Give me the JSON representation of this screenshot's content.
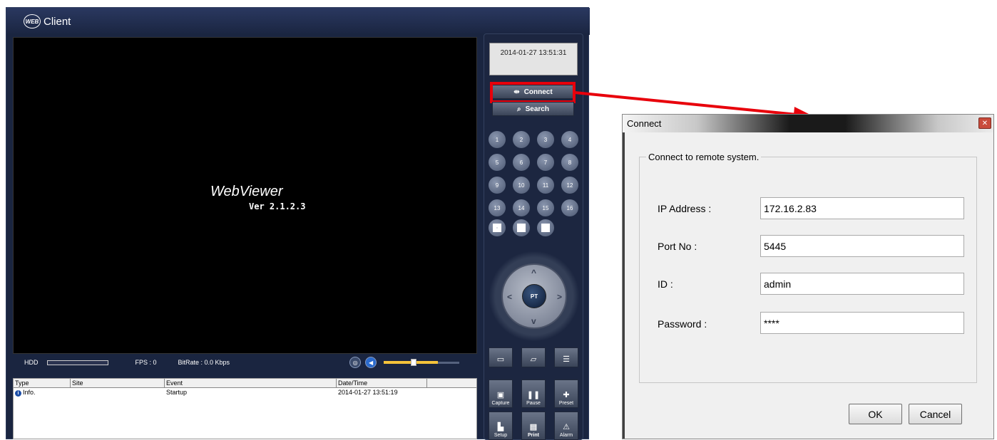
{
  "app": {
    "logo_text": "WEB",
    "title": "Client"
  },
  "viewer": {
    "name": "WebViewer",
    "version": "Ver 2.1.2.3"
  },
  "status": {
    "hdd_label": "HDD",
    "fps": "FPS :  0",
    "bitrate": "BitRate : 0.0 Kbps",
    "volume_level": 0.5
  },
  "log": {
    "columns": [
      "Type",
      "Site",
      "Event",
      "Date/Time"
    ],
    "rows": [
      {
        "type": "Info.",
        "site": "",
        "event": "Startup",
        "datetime": "2014-01-27 13:51:19"
      }
    ]
  },
  "panel": {
    "clock": "2014-01-27 13:51:31",
    "connect_label": "Connect",
    "search_label": "Search",
    "channels": [
      "1",
      "2",
      "3",
      "4",
      "5",
      "6",
      "7",
      "8",
      "9",
      "10",
      "11",
      "12",
      "13",
      "14",
      "15",
      "16"
    ],
    "ptz_label": "PT",
    "tools": [
      {
        "label": "",
        "icon": "video-icon"
      },
      {
        "label": "",
        "icon": "image-icon"
      },
      {
        "label": "",
        "icon": "list-icon"
      },
      {
        "label": "Capture",
        "icon": "capture-icon"
      },
      {
        "label": "Pause",
        "icon": "pause-icon"
      },
      {
        "label": "Preset",
        "icon": "preset-icon"
      },
      {
        "label": "Setup",
        "icon": "setup-icon"
      },
      {
        "label": "Print",
        "icon": "print-icon"
      },
      {
        "label": "Alarm",
        "icon": "alarm-icon"
      }
    ]
  },
  "dialog": {
    "title": "Connect",
    "group_label": "Connect to remote system.",
    "ip_label": "IP Address :",
    "ip_value": "172.16.2.83",
    "port_label": "Port No :",
    "port_value": "5445",
    "id_label": "ID :",
    "id_value": "admin",
    "password_label": "Password :",
    "password_value": "****",
    "ok_label": "OK",
    "cancel_label": "Cancel"
  },
  "colors": {
    "highlight": "#e8000b",
    "app_bg": "#1a2540"
  }
}
